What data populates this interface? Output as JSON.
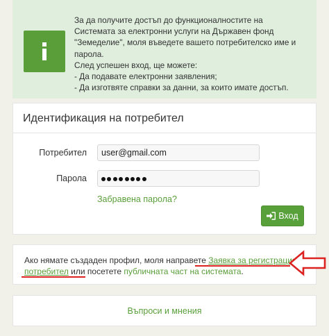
{
  "info": {
    "icon": "info-icon",
    "lines": [
      "За да получите достъп до функционалностите на",
      "Системата за електронни услуги на Държавен фонд",
      "\"Земеделие\", моля въведете вашето потребителско име и",
      "парола.",
      "След успешен вход, ще можете:",
      "- Да подавате електронни заявления;",
      "- Да изготвяте справки за данни, за които имате достъп."
    ]
  },
  "login": {
    "title": "Идентификация на потребител",
    "user_label": "Потребител",
    "user_value": "user@gmail.com",
    "pass_label": "Парола",
    "pass_dots": 8,
    "forgot_label": "Забравена парола?",
    "login_label": "Вход",
    "login_icon": "sign-in-icon"
  },
  "registration": {
    "text_before": "Ако нямате създаден профил, моля направете ",
    "reg_link_part1": "Заявка за регистрация на",
    "reg_link_part2": "потребител",
    "text_middle": " или посетете ",
    "public_link": "публичната част на системата",
    "text_end": "."
  },
  "feedback": {
    "label": "Въпроси и мнения"
  },
  "colors": {
    "accent": "#5a9e3a",
    "highlight": "#d22222"
  }
}
